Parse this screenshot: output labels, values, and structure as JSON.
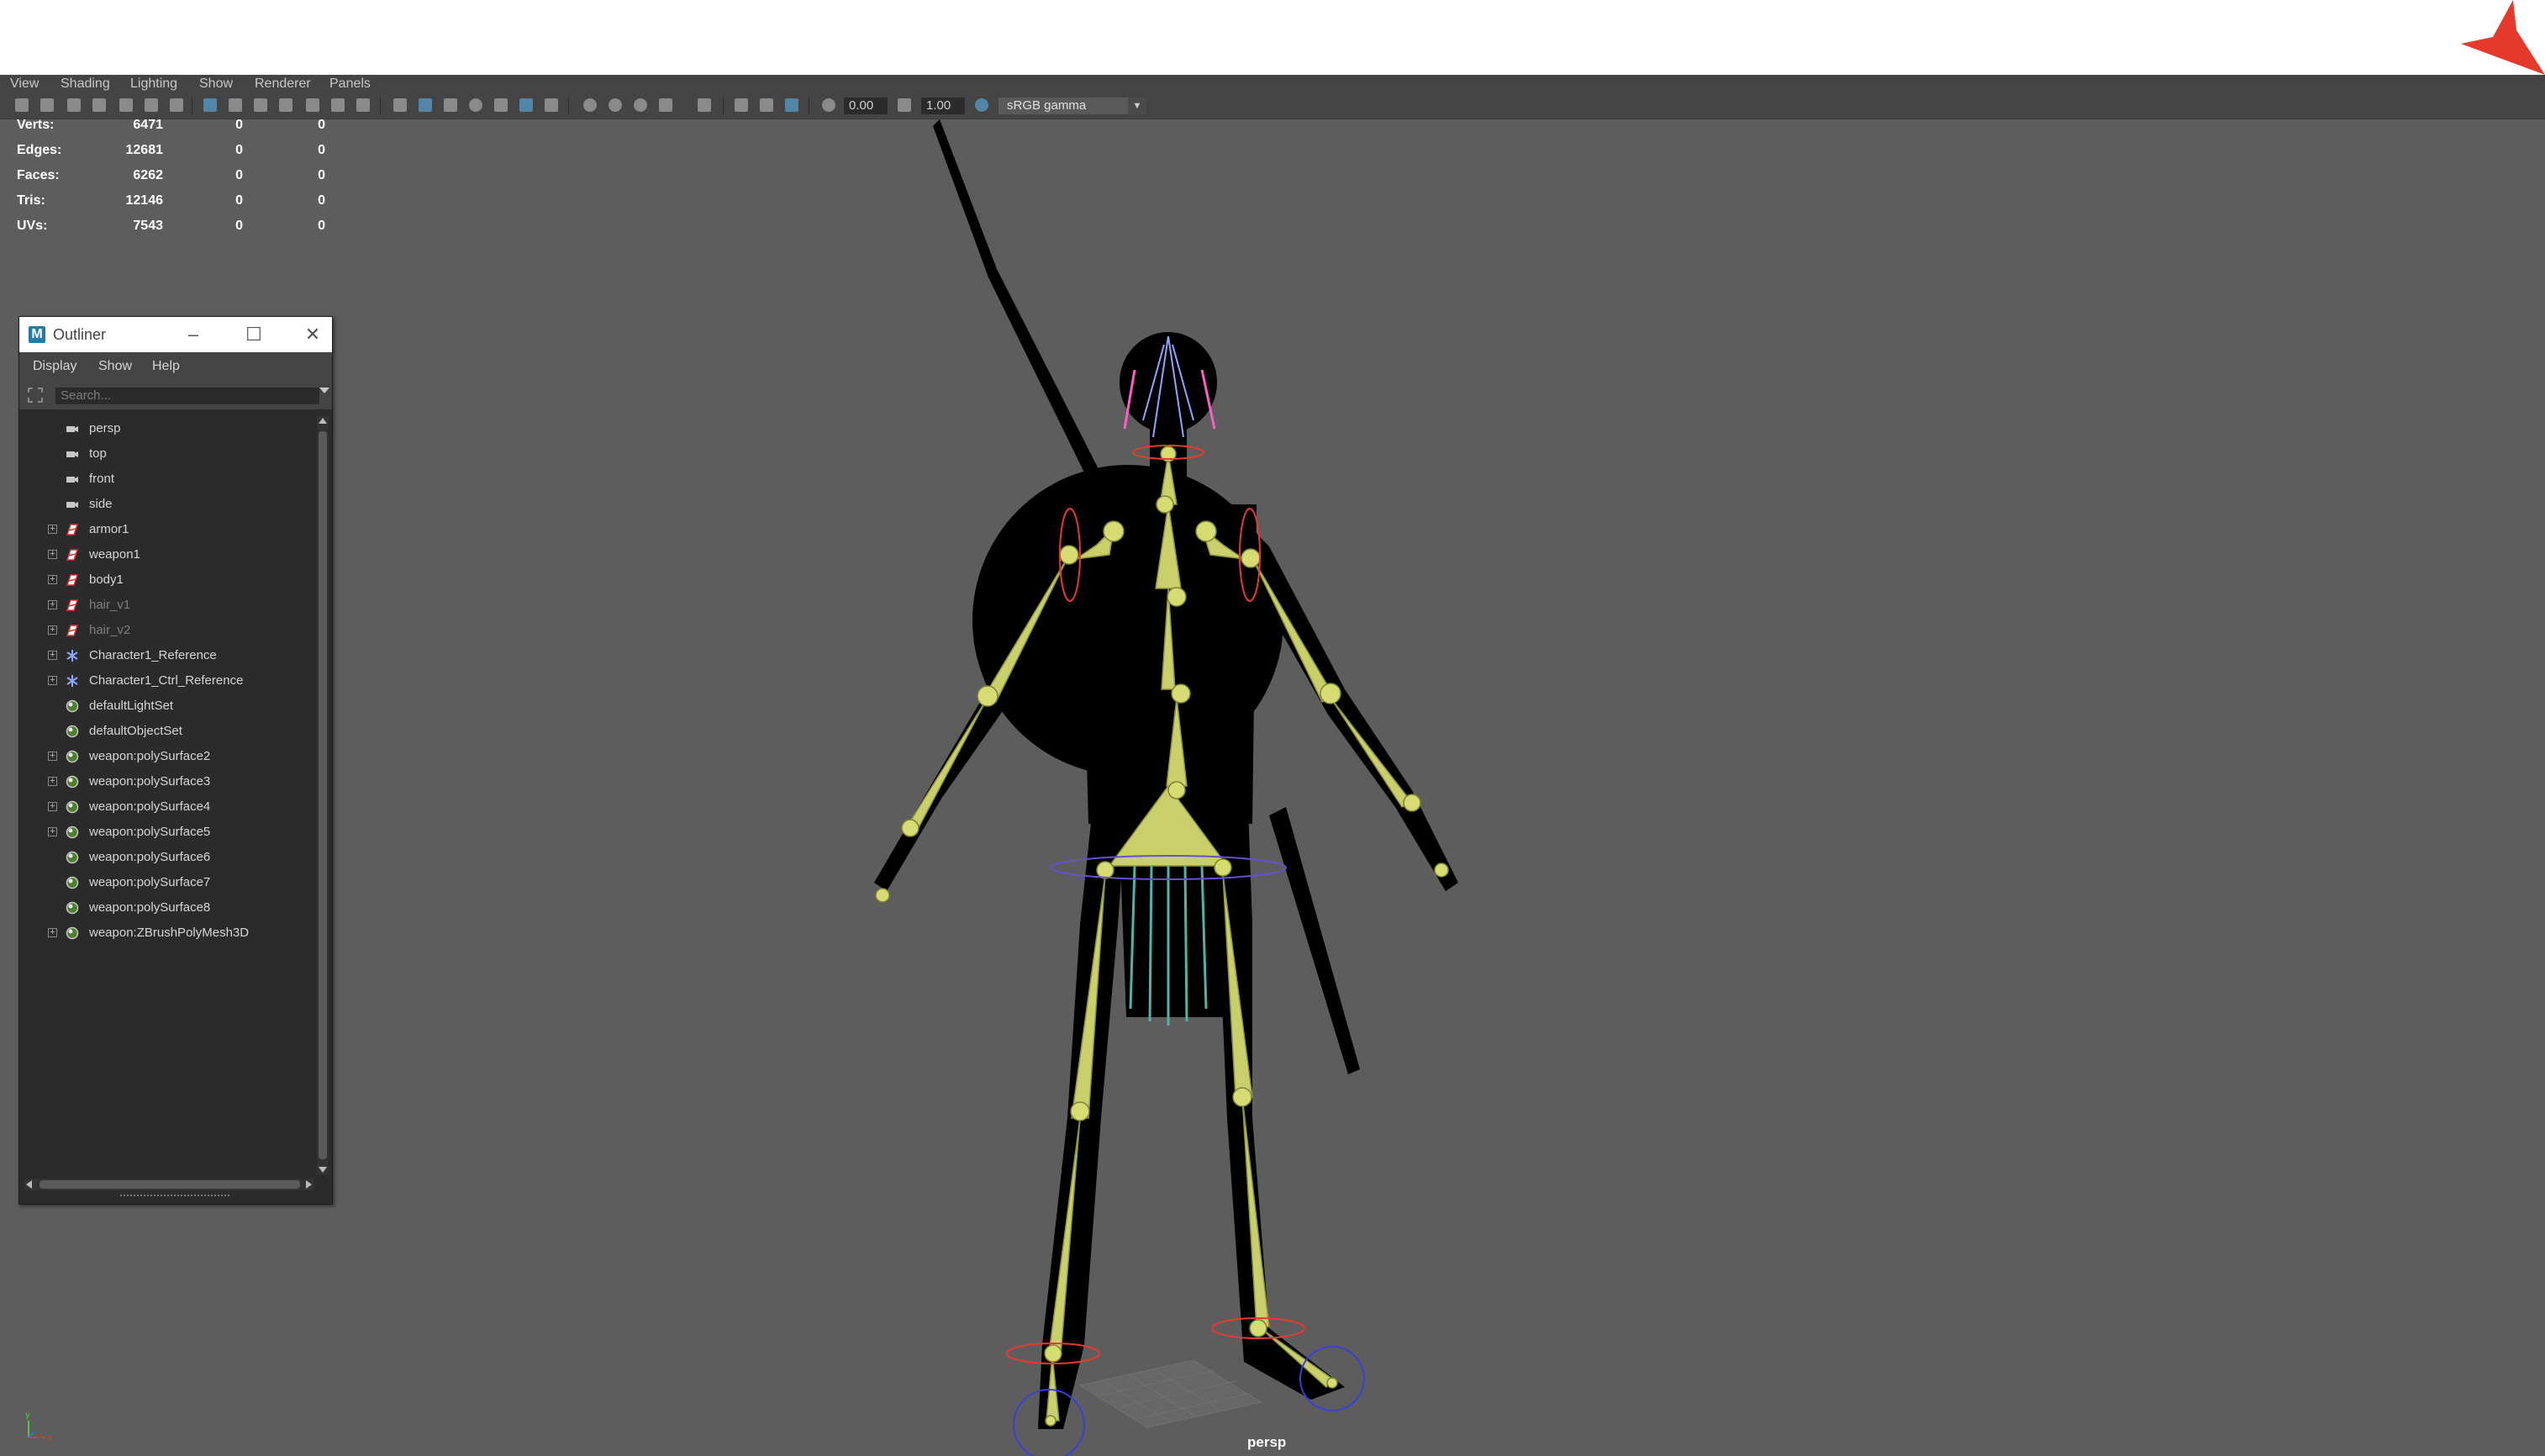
{
  "menubar": {
    "items": [
      "View",
      "Shading",
      "Lighting",
      "Show",
      "Renderer",
      "Panels"
    ]
  },
  "toolbar": {
    "exposure_value": "0.00",
    "gamma_value": "1.00",
    "color_space": "sRGB gamma",
    "icons": [
      "select-camera",
      "camera-attributes",
      "bookmark",
      "image-plane",
      "grease-pencil",
      "grid",
      "film-gate",
      "resolution-gate",
      "safe-action",
      "isolate-select",
      "wireframe",
      "smooth-shade",
      "default-material",
      "textures",
      "lights",
      "shadows",
      "ambient-occlusion",
      "motion-blur",
      "multisample",
      "depth-of-field",
      "xray",
      "xray-joints",
      "xray-active",
      "hud",
      "exposure",
      "gamma",
      "color-management"
    ]
  },
  "hud": {
    "rows": [
      {
        "label": "Verts:",
        "values": [
          "6471",
          "0",
          "0"
        ]
      },
      {
        "label": "Edges:",
        "values": [
          "12681",
          "0",
          "0"
        ]
      },
      {
        "label": "Faces:",
        "values": [
          "6262",
          "0",
          "0"
        ]
      },
      {
        "label": "Tris:",
        "values": [
          "12146",
          "0",
          "0"
        ]
      },
      {
        "label": "UVs:",
        "values": [
          "7543",
          "0",
          "0"
        ]
      }
    ]
  },
  "outliner": {
    "title": "Outliner",
    "menus": [
      "Display",
      "Show",
      "Help"
    ],
    "search_placeholder": "Search...",
    "items": [
      {
        "label": "persp",
        "icon": "camera-icon",
        "expandable": false,
        "dim": false
      },
      {
        "label": "top",
        "icon": "camera-icon",
        "expandable": false,
        "dim": false
      },
      {
        "label": "front",
        "icon": "camera-icon",
        "expandable": false,
        "dim": false
      },
      {
        "label": "side",
        "icon": "camera-icon",
        "expandable": false,
        "dim": false
      },
      {
        "label": "armor1",
        "icon": "mesh-icon",
        "expandable": true,
        "dim": false
      },
      {
        "label": "weapon1",
        "icon": "mesh-icon",
        "expandable": true,
        "dim": false
      },
      {
        "label": "body1",
        "icon": "mesh-icon",
        "expandable": true,
        "dim": false
      },
      {
        "label": "hair_v1",
        "icon": "mesh-icon",
        "expandable": true,
        "dim": true
      },
      {
        "label": "hair_v2",
        "icon": "mesh-icon",
        "expandable": true,
        "dim": true
      },
      {
        "label": "Character1_Reference",
        "icon": "joint-icon",
        "expandable": true,
        "dim": false
      },
      {
        "label": "Character1_Ctrl_Reference",
        "icon": "joint-icon",
        "expandable": true,
        "dim": false
      },
      {
        "label": "defaultLightSet",
        "icon": "set-icon",
        "expandable": false,
        "dim": false
      },
      {
        "label": "defaultObjectSet",
        "icon": "set-icon",
        "expandable": false,
        "dim": false
      },
      {
        "label": "weapon:polySurface2",
        "icon": "set-icon",
        "expandable": true,
        "dim": false
      },
      {
        "label": "weapon:polySurface3",
        "icon": "set-icon",
        "expandable": true,
        "dim": false
      },
      {
        "label": "weapon:polySurface4",
        "icon": "set-icon",
        "expandable": true,
        "dim": false
      },
      {
        "label": "weapon:polySurface5",
        "icon": "set-icon",
        "expandable": true,
        "dim": false
      },
      {
        "label": "weapon:polySurface6",
        "icon": "set-icon",
        "expandable": false,
        "dim": false
      },
      {
        "label": "weapon:polySurface7",
        "icon": "set-icon",
        "expandable": false,
        "dim": false
      },
      {
        "label": "weapon:polySurface8",
        "icon": "set-icon",
        "expandable": false,
        "dim": false
      },
      {
        "label": "weapon:ZBrushPolyMesh3D",
        "icon": "set-icon",
        "expandable": true,
        "dim": false
      }
    ]
  },
  "viewport": {
    "camera_label": "persp",
    "background": "#5d5d5d",
    "bone_color": "#c9cf6a",
    "accent_color": "#e53a2e"
  }
}
